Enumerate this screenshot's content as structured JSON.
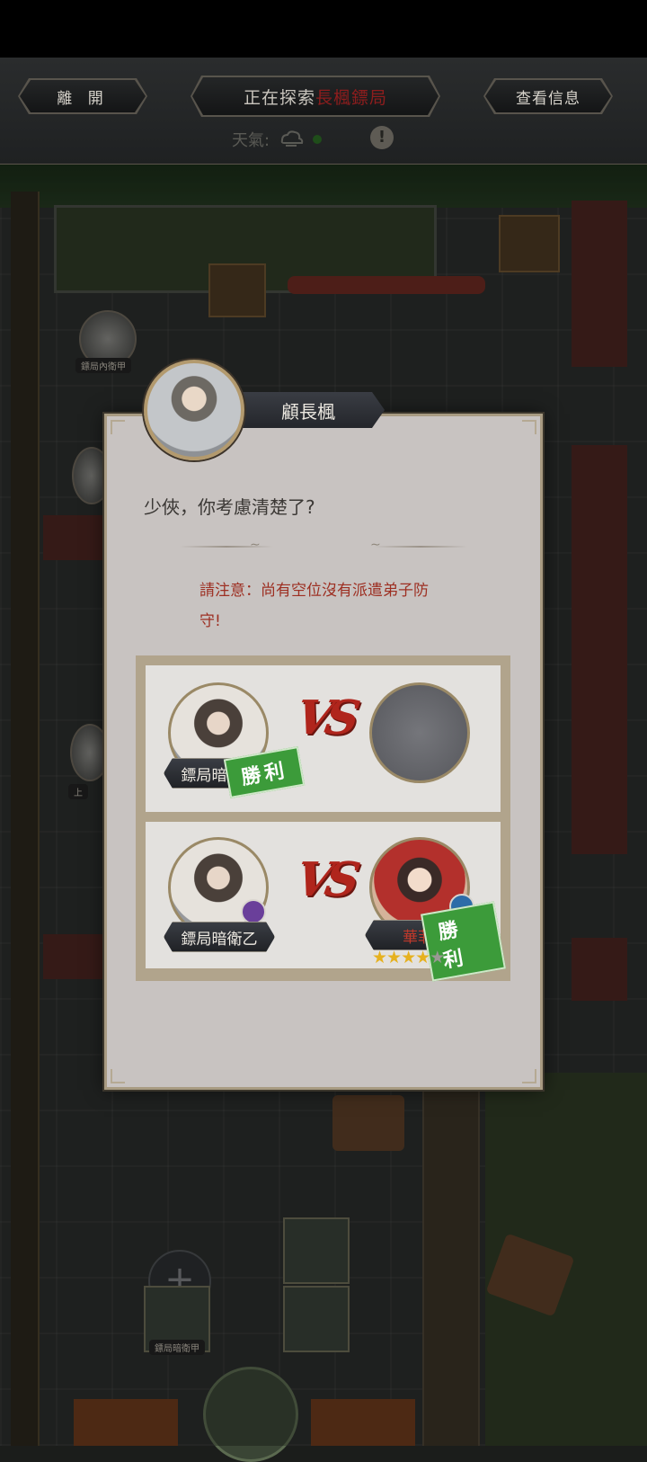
{
  "header": {
    "leave_label": "離 開",
    "exploring_prefix": "正在探索",
    "exploring_place": "長楓鏢局",
    "info_label": "查看信息",
    "weather_label": "天氣:",
    "weather_icon": "cloud-icon",
    "alert_icon": "exclamation-icon"
  },
  "map": {
    "token_labels": [
      "鏢局內衛甲",
      "上",
      "鏢局暗衛甲"
    ]
  },
  "dialog": {
    "speaker_name": "顧長楓",
    "question": "少俠，你考慮清楚了?",
    "warning": "請注意：尚有空位沒有派遣弟子防守!",
    "vs_label": "VS",
    "win_label": "勝利",
    "battles": [
      {
        "ally_name": "鏢局暗衛甲",
        "enemy_name": "",
        "result": "ally-win"
      },
      {
        "ally_name": "鏢局暗衛乙",
        "enemy_name": "華菲",
        "enemy_stars": 4,
        "enemy_max_stars": 5,
        "result": "enemy-win"
      }
    ]
  },
  "colors": {
    "accent_red": "#9d2f22",
    "win_green": "#3c9b3a",
    "panel_bg": "#c8c3c1"
  }
}
